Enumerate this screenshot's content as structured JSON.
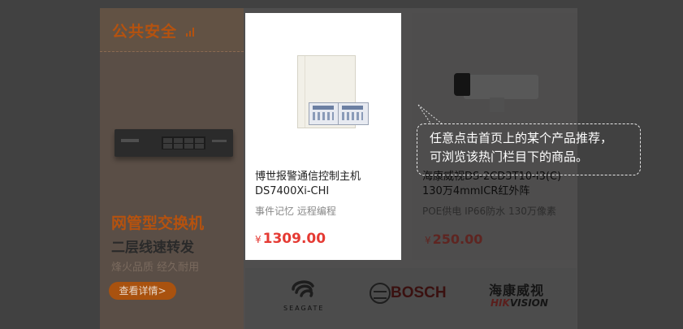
{
  "promo": {
    "title": "公共安全",
    "headline": "网管型交换机",
    "subhead": "二层线速转发",
    "desc": "烽火品质 经久耐用",
    "button": "查看详情>",
    "icons": [
      "bars-icon",
      "switch-image"
    ]
  },
  "products": [
    {
      "name": "博世报警通信控制主机DS7400Xi-CHI",
      "features": "事件记忆 远程编程",
      "currency": "¥",
      "price": "1309.00",
      "image": "alarm-panel-image"
    },
    {
      "name": "海康威视DS-2CD3T10-I3(C) 130万4mmICR红外阵",
      "features": "POE供电 IP66防水 130万像素",
      "currency": "¥",
      "price": "250.00",
      "image": "bullet-camera-image"
    }
  ],
  "brands": {
    "seagate": "SEAGATE",
    "bosch": "BOSCH",
    "hikvision_cn": "海康威视",
    "hikvision_en_1": "HIK",
    "hikvision_en_2": "VISION"
  },
  "tooltip": {
    "line1": "任意点击首页上的某个产品推荐，",
    "line2": "可浏览该热门栏目下的商品。"
  },
  "colors": {
    "accent": "#b5520f",
    "price": "#e53a33",
    "overlay": "#414141"
  }
}
